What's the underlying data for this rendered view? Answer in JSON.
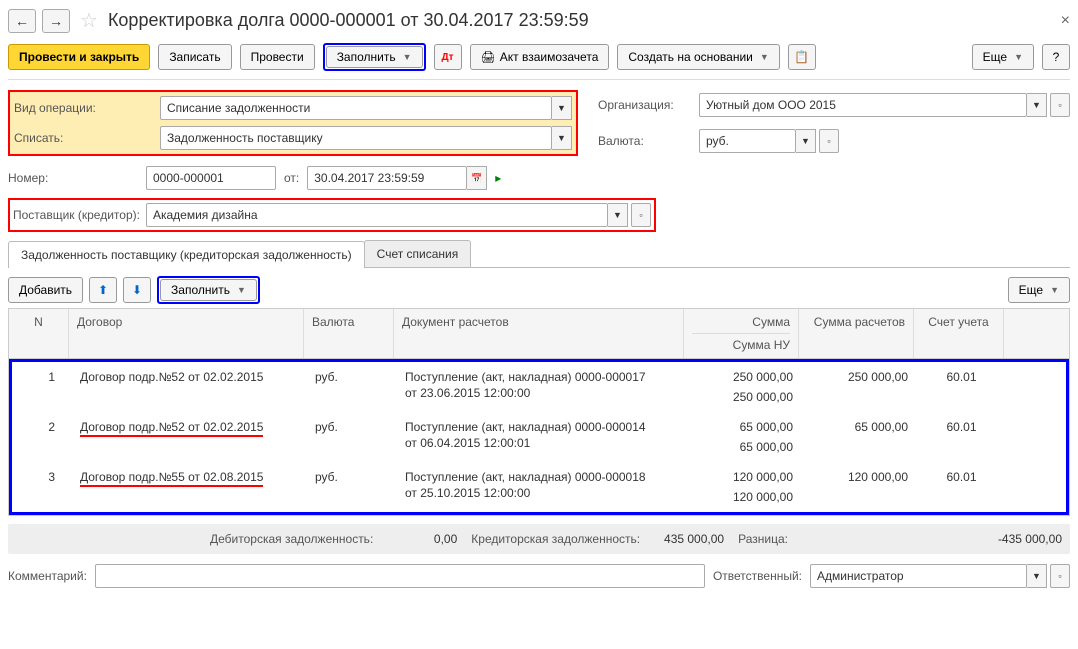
{
  "title": "Корректировка долга 0000-000001 от 30.04.2017 23:59:59",
  "toolbar": {
    "post_close": "Провести и закрыть",
    "save": "Записать",
    "post": "Провести",
    "fill": "Заполнить",
    "act": "Акт взаимозачета",
    "create_based": "Создать на основании",
    "more": "Еще"
  },
  "form": {
    "op_type_label": "Вид операции:",
    "op_type": "Списание задолженности",
    "writeoff_label": "Списать:",
    "writeoff": "Задолженность поставщику",
    "org_label": "Организация:",
    "org": "Уютный дом ООО 2015",
    "cur_label": "Валюта:",
    "cur": "руб.",
    "num_label": "Номер:",
    "num": "0000-000001",
    "from_label": "от:",
    "date": "30.04.2017 23:59:59",
    "supplier_label": "Поставщик (кредитор):",
    "supplier": "Академия дизайна"
  },
  "tabs": {
    "tab1": "Задолженность поставщику (кредиторская задолженность)",
    "tab2": "Счет списания"
  },
  "table_toolbar": {
    "add": "Добавить",
    "fill": "Заполнить",
    "more": "Еще"
  },
  "table_head": {
    "n": "N",
    "contract": "Договор",
    "currency": "Валюта",
    "doc": "Документ расчетов",
    "sum": "Сумма",
    "sum_nu": "Сумма НУ",
    "sum_r": "Сумма расчетов",
    "account": "Счет учета"
  },
  "rows": [
    {
      "n": "1",
      "contract": "Договор подр.№52 от 02.02.2015",
      "cur": "руб.",
      "doc1": "Поступление (акт, накладная) 0000-000017",
      "doc2": "от 23.06.2015 12:00:00",
      "sum": "250 000,00",
      "sum_nu": "250 000,00",
      "sum_r": "250 000,00",
      "acc": "60.01",
      "ul": false
    },
    {
      "n": "2",
      "contract": "Договор подр.№52 от 02.02.2015",
      "cur": "руб.",
      "doc1": "Поступление (акт, накладная) 0000-000014",
      "doc2": "от 06.04.2015 12:00:01",
      "sum": "65 000,00",
      "sum_nu": "65 000,00",
      "sum_r": "65 000,00",
      "acc": "60.01",
      "ul": true
    },
    {
      "n": "3",
      "contract": "Договор подр.№55 от 02.08.2015",
      "cur": "руб.",
      "doc1": "Поступление (акт, накладная) 0000-000018",
      "doc2": "от 25.10.2015 12:00:00",
      "sum": "120 000,00",
      "sum_nu": "120 000,00",
      "sum_r": "120 000,00",
      "acc": "60.01",
      "ul": true
    }
  ],
  "totals": {
    "debit_label": "Дебиторская задолженность:",
    "debit": "0,00",
    "credit_label": "Кредиторская задолженность:",
    "credit": "435 000,00",
    "diff_label": "Разница:",
    "diff": "-435 000,00"
  },
  "footer": {
    "comment_label": "Комментарий:",
    "resp_label": "Ответственный:",
    "resp": "Администратор"
  }
}
